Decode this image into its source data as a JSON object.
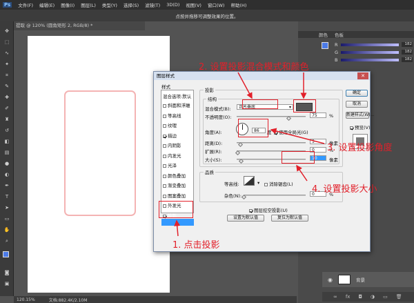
{
  "menubar": {
    "app_logo": "Ps",
    "items": [
      "文件(F)",
      "编辑(E)",
      "图像(I)",
      "图层(L)",
      "类型(Y)",
      "选择(S)",
      "滤镜(T)",
      "3D(D)",
      "视图(V)",
      "窗口(W)",
      "帮助(H)"
    ]
  },
  "options_bar": {
    "hint": "点按并拖移可调整效果的位置。"
  },
  "document": {
    "tab_title": "提取 @ 120% (圆角矩形 2, RGB/8) *"
  },
  "status": {
    "zoom": "120.15%",
    "doc_info": "文档:882.4K/2.10M"
  },
  "right_panel": {
    "tab_color": "颜色",
    "tab_swatches": "色板",
    "rgb_labels": [
      "R",
      "G",
      "B"
    ],
    "rgb_values": [
      "182",
      "182",
      "182"
    ],
    "layer_name": "背景"
  },
  "dialog": {
    "title": "图层样式",
    "close_label": "✕",
    "styles_header": "样式",
    "blend_options": "混合选项:默认",
    "styles": [
      {
        "label": "斜面和浮雕",
        "checked": false
      },
      {
        "label": "等高线",
        "checked": false
      },
      {
        "label": "纹理",
        "checked": false
      },
      {
        "label": "描边",
        "checked": true
      },
      {
        "label": "内阴影",
        "checked": false
      },
      {
        "label": "内发光",
        "checked": false
      },
      {
        "label": "光泽",
        "checked": false
      },
      {
        "label": "颜色叠加",
        "checked": false
      },
      {
        "label": "渐变叠加",
        "checked": false
      },
      {
        "label": "图案叠加",
        "checked": false
      },
      {
        "label": "外发光",
        "checked": false
      },
      {
        "label": "投影",
        "checked": true,
        "selected": true
      }
    ],
    "section_title": "投影",
    "structure_title": "结构",
    "blend_mode_label": "混合模式(B):",
    "blend_mode_value": "正片叠底",
    "opacity_label": "不透明度(O):",
    "opacity_value": "75",
    "percent": "%",
    "angle_label": "角度(A):",
    "angle_value": "86",
    "angle_unit": "度",
    "global_light_label": "使用全局光(G)",
    "distance_label": "距离(D):",
    "distance_value": "5",
    "spread_label": "扩展(R):",
    "spread_value": "0",
    "size_label": "大小(S):",
    "size_value": "10",
    "pixel_unit": "像素",
    "quality_title": "品质",
    "contour_label": "等高线:",
    "antialias_label": "消除锯齿(L)",
    "noise_label": "杂色(N):",
    "noise_value": "0",
    "knockout_label": "图层挖空投影(U)",
    "make_default": "设置为默认值",
    "reset_default": "复位为默认值",
    "buttons": {
      "ok": "确定",
      "cancel": "取消",
      "new_style": "新建样式(W)...",
      "preview": "预览(V)"
    },
    "shadow_color": "#555555"
  },
  "annotations": {
    "step1": "1. 点击投影",
    "step2": "2. 设置投影混合模式和颜色",
    "step3": "3. 设置投影角度",
    "step4": "4. 设置投影大小",
    "color": "#e2202a"
  }
}
